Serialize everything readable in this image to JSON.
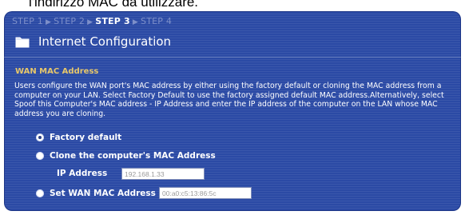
{
  "caption": "l'indirizzo MAC da utilizzare.",
  "wizard": {
    "steps": [
      {
        "label": "STEP 1",
        "active": false
      },
      {
        "label": "STEP 2",
        "active": false
      },
      {
        "label": "STEP 3",
        "active": true
      },
      {
        "label": "STEP 4",
        "active": false
      }
    ],
    "title": "Internet Configuration",
    "section_title": "WAN MAC Address",
    "description": "Users configure the WAN port's MAC address by either using the factory default or cloning the MAC address from a computer on your LAN. Select Factory Default to use the factory assigned default MAC address.Alternatively, select Spoof this Computer's MAC address - IP Address and enter the IP address of the computer on the LAN whose MAC address you are cloning.",
    "options": {
      "factory_default": {
        "label": "Factory default",
        "selected": true
      },
      "clone": {
        "label": "Clone the computer's MAC Address",
        "selected": false
      },
      "set_wan": {
        "label": "Set WAN MAC Address",
        "selected": false
      }
    },
    "ip_address": {
      "label": "IP Address",
      "value": "192.168.1.33"
    },
    "mac_address_value": "00:a0:c5:13:86:5c"
  },
  "colors": {
    "panel": "#2b4aa5",
    "section_title": "#e7c76a",
    "inactive_step": "#7d8fc9"
  },
  "icons": {
    "title_icon": "folder-icon",
    "step_separator": "chevron-right-icon"
  }
}
